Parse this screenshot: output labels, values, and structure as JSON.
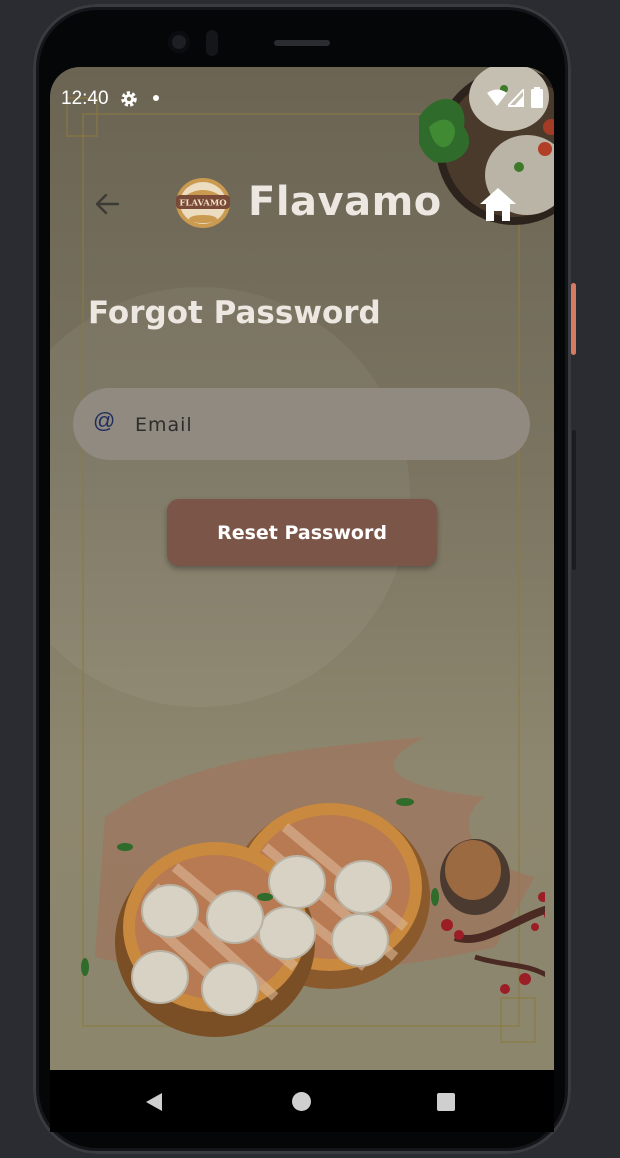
{
  "status_bar": {
    "time": "12:40",
    "icons": [
      "gear-icon",
      "notification-dot-icon",
      "wifi-icon",
      "signal-icon",
      "battery-icon"
    ]
  },
  "app_bar": {
    "brand": "Flavamo",
    "logo_text": "FLAVAMO",
    "back_icon": "back-arrow-icon",
    "home_icon": "home-icon"
  },
  "page": {
    "title": "Forgot Password"
  },
  "form": {
    "email_placeholder": "Email",
    "email_value": "",
    "email_icon": "@",
    "reset_label": "Reset Password"
  },
  "nav_bar": {
    "icons": [
      "back-triangle-icon",
      "home-circle-icon",
      "recents-square-icon"
    ]
  },
  "colors": {
    "button": "#7a5548",
    "field": "#908a80",
    "title_text": "#ece7e0",
    "email_icon": "#1f2d5c"
  }
}
